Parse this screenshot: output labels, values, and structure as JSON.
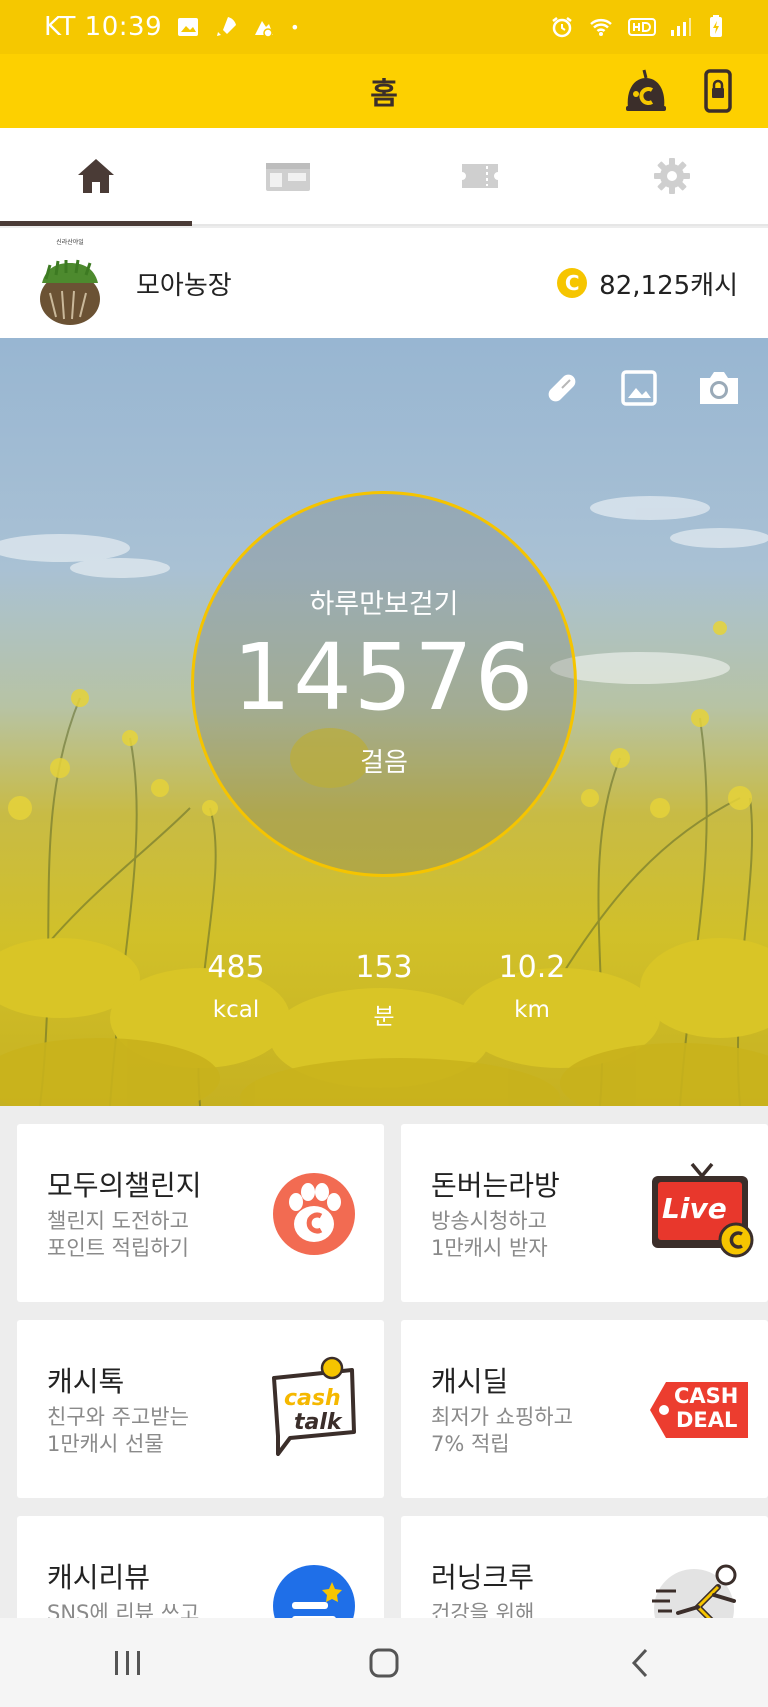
{
  "status_bar": {
    "carrier_time": "KT 10:39",
    "dot": "•",
    "icons": [
      "gallery-icon",
      "rocket-icon",
      "cashslide-icon",
      "alarm-icon",
      "wifi-icon",
      "hd-icon",
      "signal-icon",
      "battery-icon"
    ]
  },
  "app_bar": {
    "title": "홈",
    "actions": [
      "cashwalk-character-icon",
      "phone-lock-icon"
    ]
  },
  "tabs": [
    {
      "icon": "home-icon",
      "active": true
    },
    {
      "icon": "store-icon",
      "active": false
    },
    {
      "icon": "ticket-icon",
      "active": false
    },
    {
      "icon": "gear-icon",
      "active": false
    }
  ],
  "profile": {
    "avatar_caption": "신라산야일",
    "farm_name": "모아농장",
    "coin_symbol": "C",
    "cash": "82,125캐시"
  },
  "hero": {
    "actions": [
      "pill-icon",
      "image-icon",
      "camera-icon"
    ],
    "ring_title": "하루만보걷기",
    "steps": "14576",
    "steps_unit": "걸음",
    "stats": [
      {
        "value": "485",
        "unit": "kcal"
      },
      {
        "value": "153",
        "unit": "분"
      },
      {
        "value": "10.2",
        "unit": "km"
      }
    ],
    "ring_color": "#f5c400"
  },
  "cards": [
    {
      "title": "모두의챌린지",
      "line1": "챌린지 도전하고",
      "line2": "포인트 적립하기",
      "icon": "paw-c-icon"
    },
    {
      "title": "돈버는라방",
      "line1": "방송시청하고",
      "line2": "1만캐시 받자",
      "icon": "live-tv-icon",
      "icon_text": "Live"
    },
    {
      "title": "캐시톡",
      "line1": "친구와 주고받는",
      "line2": "1만캐시 선물",
      "icon": "cash-talk-icon",
      "icon_text1": "cash",
      "icon_text2": "talk"
    },
    {
      "title": "캐시딜",
      "line1": "최저가 쇼핑하고",
      "line2": "7% 적립",
      "icon": "cash-deal-icon",
      "icon_text1": "CASH",
      "icon_text2": "DEAL"
    },
    {
      "title": "캐시리뷰",
      "line1": "SNS에 리뷰 쓰고",
      "line2": "",
      "icon": "review-star-icon"
    },
    {
      "title": "러닝크루",
      "line1": "건강을 위해",
      "line2": "",
      "icon": "running-man-icon"
    }
  ],
  "colors": {
    "status_bar": "#f5c800",
    "app_bar": "#fdd000",
    "brand_brown": "#4a3b36",
    "coin": "#f6c500"
  },
  "nav_bar": [
    "recent-apps-icon",
    "home-button-icon",
    "back-icon"
  ]
}
